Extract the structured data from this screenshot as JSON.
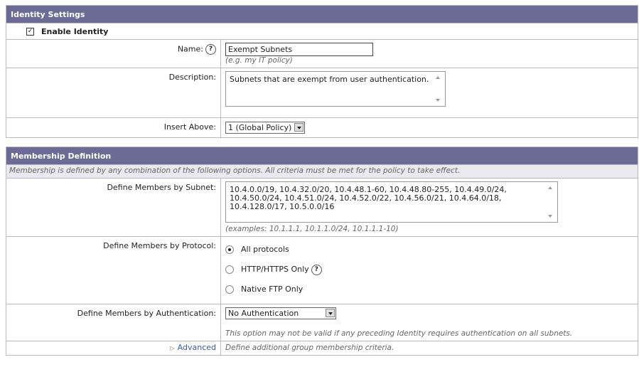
{
  "identity": {
    "header": "Identity Settings",
    "enable_label": "Enable Identity",
    "name_label": "Name:",
    "name_value": "Exempt Subnets",
    "name_hint": "(e.g. my IT policy)",
    "description_label": "Description:",
    "description_value": "Subnets that are exempt from user authentication.",
    "insert_above_label": "Insert Above:",
    "insert_above_value": "1 (Global Policy)"
  },
  "membership": {
    "header": "Membership Definition",
    "intro": "Membership is defined by any combination of the following options. All criteria must be met for the policy to take effect.",
    "subnet_label": "Define Members by Subnet:",
    "subnet_value": "10.4.0.0/19, 10.4.32.0/20, 10.4.48.1-60, 10.4.48.80-255, 10.4.49.0/24, 10.4.50.0/24, 10.4.51.0/24, 10.4.52.0/22, 10.4.56.0/21, 10.4.64.0/18, 10.4.128.0/17, 10.5.0.0/16",
    "subnet_examples": "(examples: 10.1.1.1, 10.1.1.0/24, 10.1.1.1-10)",
    "protocol_label": "Define Members by Protocol:",
    "protocol_options": [
      "All protocols",
      "HTTP/HTTPS Only",
      "Native FTP Only"
    ],
    "protocol_selected": "All protocols",
    "auth_label": "Define Members by Authentication:",
    "auth_value": "No Authentication",
    "auth_note": "This option may not be valid if any preceding Identity requires authentication on all subnets.",
    "advanced_label": "Advanced",
    "advanced_note": "Define additional group membership criteria."
  },
  "icons": {
    "help": "?",
    "checkbox": "checkbox-checked-icon",
    "expand": "triangle-right-icon"
  }
}
